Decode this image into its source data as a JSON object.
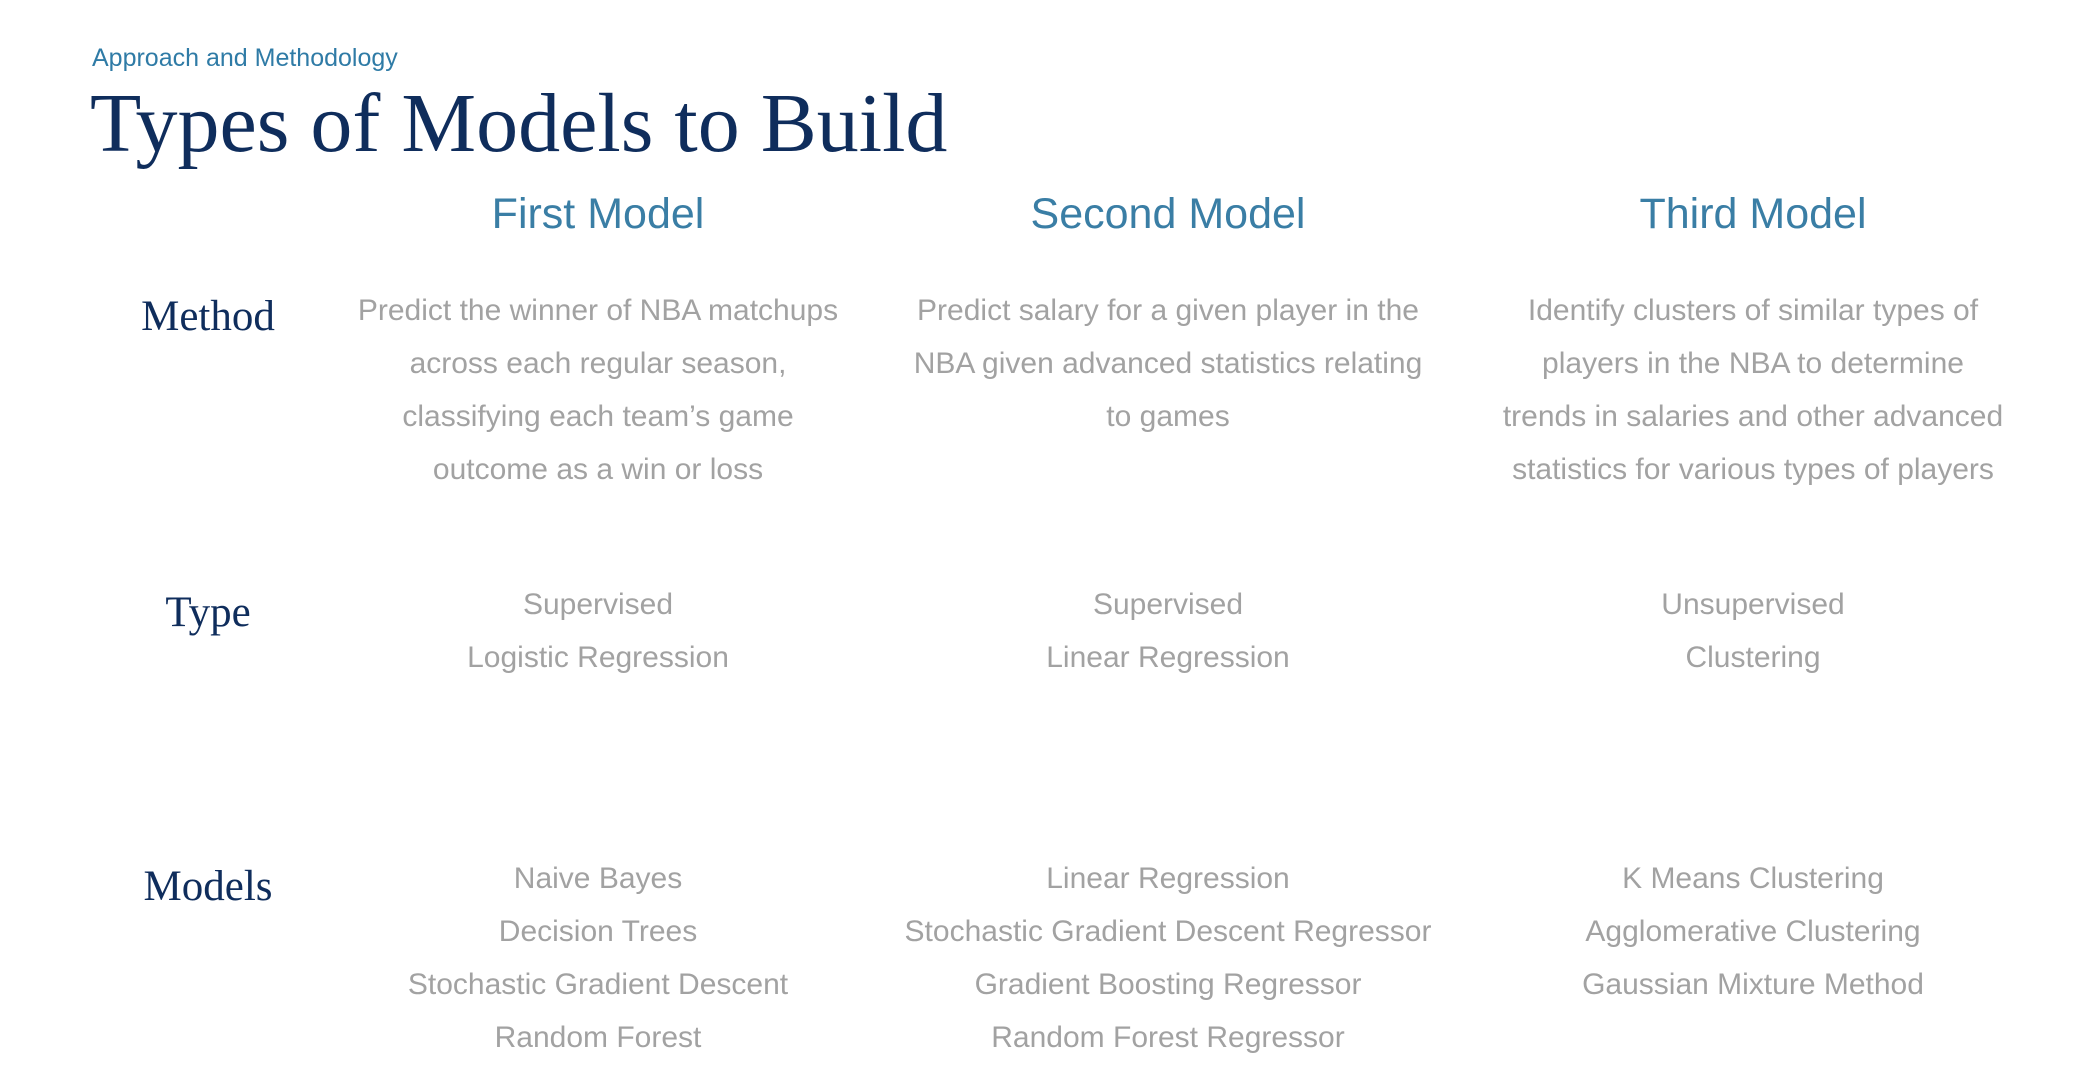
{
  "header": {
    "kicker": "Approach and Methodology",
    "title": "Types of Models to Build"
  },
  "columns": [
    {
      "label": "First Model"
    },
    {
      "label": "Second Model"
    },
    {
      "label": "Third Model"
    }
  ],
  "rows": {
    "method": {
      "label": "Method"
    },
    "type": {
      "label": "Type"
    },
    "models": {
      "label": "Models"
    }
  },
  "cells": {
    "method": [
      [
        "Predict the winner of NBA matchups",
        "across each regular season,",
        "classifying each team’s game",
        "outcome as  a win or loss"
      ],
      [
        "Predict salary for a given player in the",
        "NBA given advanced statistics relating",
        "to games"
      ],
      [
        "Identify clusters of similar types of",
        "players in the NBA to determine",
        "trends in salaries and other advanced",
        "statistics for various types of players"
      ]
    ],
    "type": [
      [
        "Supervised",
        "Logistic Regression"
      ],
      [
        "Supervised",
        "Linear Regression"
      ],
      [
        "Unsupervised",
        "Clustering"
      ]
    ],
    "models": [
      [
        "Naive Bayes",
        "Decision Trees",
        "Stochastic Gradient Descent",
        "Random Forest"
      ],
      [
        "Linear Regression",
        "Stochastic Gradient Descent Regressor",
        "Gradient Boosting Regressor",
        "Random Forest Regressor"
      ],
      [
        "K Means Clustering",
        "Agglomerative Clustering",
        "Gaussian Mixture Method"
      ]
    ]
  }
}
